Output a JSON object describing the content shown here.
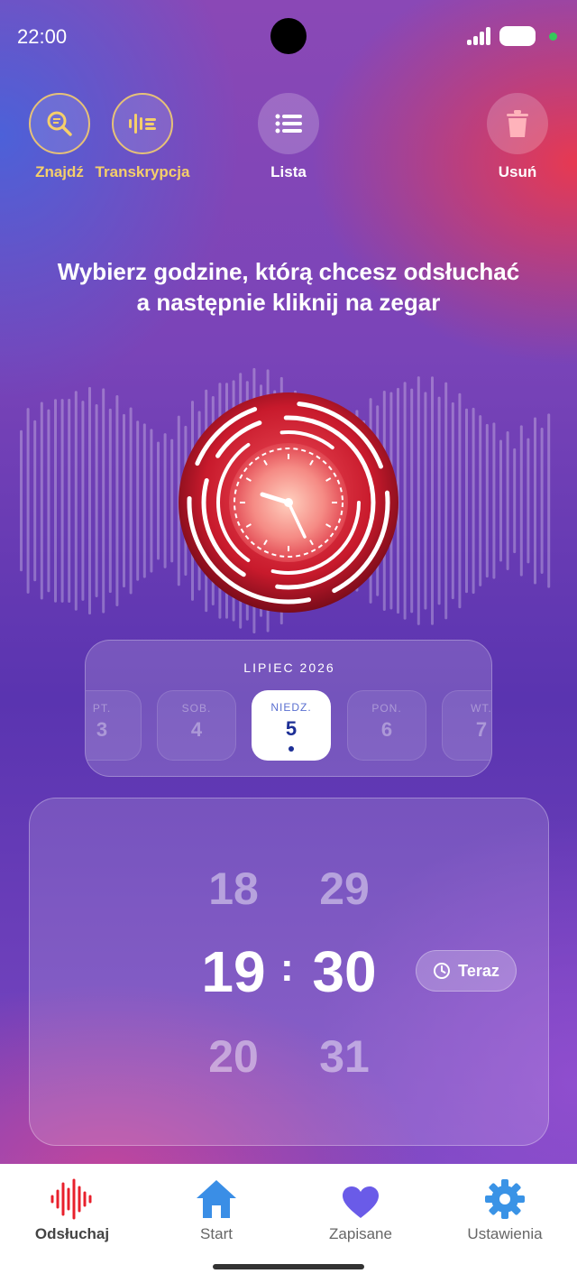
{
  "status_bar": {
    "time": "22:00"
  },
  "toolbar": {
    "find_label": "Znajdź",
    "transcribe_label": "Transkrypcja",
    "list_label": "Lista",
    "delete_label": "Usuń"
  },
  "instruction": {
    "line1": "Wybierz godzine, którą chcesz odsłuchać",
    "line2": "a następnie kliknij na zegar"
  },
  "date_picker": {
    "month": "LIPIEC 2026",
    "days": [
      {
        "name": "PT.",
        "num": "3"
      },
      {
        "name": "SOB.",
        "num": "4"
      },
      {
        "name": "NIEDZ.",
        "num": "5",
        "selected": true
      },
      {
        "name": "PON.",
        "num": "6"
      },
      {
        "name": "WT.",
        "num": "7"
      }
    ]
  },
  "time_picker": {
    "hour_prev": "18",
    "hour": "19",
    "hour_next": "20",
    "min_prev": "29",
    "min": "30",
    "min_next": "31",
    "separator": ":",
    "now_label": "Teraz"
  },
  "nav": {
    "items": [
      {
        "label": "Odsłuchaj",
        "icon": "soundwave-icon",
        "active": true
      },
      {
        "label": "Start",
        "icon": "home-icon"
      },
      {
        "label": "Zapisane",
        "icon": "heart-icon"
      },
      {
        "label": "Ustawienia",
        "icon": "gear-icon"
      }
    ]
  },
  "colors": {
    "accent_gold": "#f5cf6a",
    "selected_day_text": "#1d2f96",
    "clock_red": "#e02a3a",
    "nav_active_red": "#e8202c",
    "nav_home_blue": "#3a8ee6",
    "nav_heart_purple": "#6a5be8",
    "nav_gear_blue": "#3a93e6"
  }
}
